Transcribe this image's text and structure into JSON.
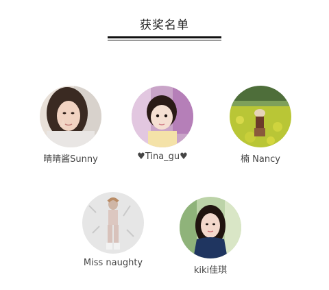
{
  "header": {
    "title": "获奖名单"
  },
  "winners": [
    {
      "name": "晴晴酱Sunny",
      "photo": "woman-selfie-peace-sign"
    },
    {
      "name": "♥Tina_gu♥",
      "photo": "little-girl-portrait"
    },
    {
      "name": "楠 Nancy",
      "photo": "woman-in-yellow-flower-field"
    },
    {
      "name": "Miss naughty",
      "photo": "fashion-figure-white-outfit"
    },
    {
      "name": "kiki佳琪",
      "photo": "woman-outdoors-blue-jacket"
    }
  ],
  "colors": {
    "title": "#222222",
    "name": "#444444",
    "rule": "#111111"
  }
}
